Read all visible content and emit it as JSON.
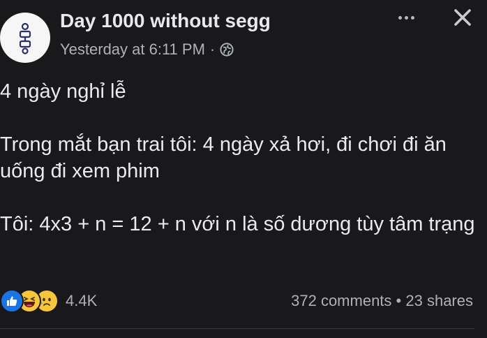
{
  "post": {
    "author": "Day 1000 without segg",
    "timestamp": "Yesterday at 6:11 PM",
    "separator": "·",
    "privacy_icon": "globe-icon",
    "more_icon": "more-horizontal-icon",
    "close_icon": "close-icon",
    "text": {
      "line1": "4 ngày nghỉ lễ",
      "line2": "Trong mắt bạn trai tôi: 4 ngày xả hơi, đi chơi đi ăn uống đi xem phim",
      "line3": "Tôi: 4x3 + n = 12 + n với n là số dương tùy tâm trạng"
    }
  },
  "engagement": {
    "reactions": [
      "like-icon",
      "haha-icon",
      "sad-icon"
    ],
    "reaction_count": "4.4K",
    "comments": "372 comments",
    "dot": "•",
    "shares": "23 shares"
  },
  "colors": {
    "background": "#19191b",
    "text": "#e4e6eb",
    "muted": "#aeb2b8",
    "like_blue": "#1b74e4",
    "emoji_yellow": "#f7c63d"
  }
}
